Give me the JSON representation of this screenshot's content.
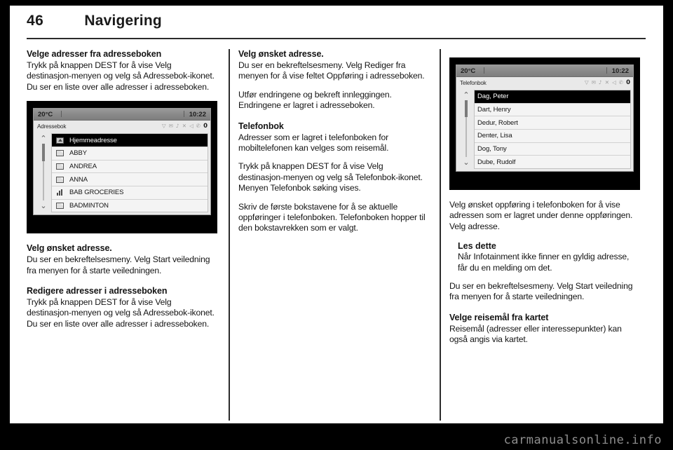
{
  "header": {
    "page_number": "46",
    "chapter": "Navigering"
  },
  "watermark": "carmanualsonline.info",
  "columns": {
    "col1": {
      "blocks": [
        {
          "kind": "heading",
          "text": "Velge adresser fra adresseboken"
        },
        {
          "kind": "body",
          "text": "Trykk på knappen DEST for å vise Velg destinasjon-menyen og velg så Adressebok-ikonet. Du ser en liste over alle adresser i adresseboken."
        },
        {
          "kind": "figure",
          "ref": "address_book_screen"
        },
        {
          "kind": "heading",
          "text": "Velg ønsket adresse."
        },
        {
          "kind": "body",
          "text": "Du ser en bekreftelsesmeny. Velg Start veiledning fra menyen for å starte veiledningen."
        },
        {
          "kind": "heading",
          "text": "Redigere adresser i adresseboken"
        },
        {
          "kind": "body",
          "text": "Trykk på knappen DEST for å vise Velg destinasjon-menyen og velg så Adressebok-ikonet. Du ser en liste over alle adresser i adresseboken."
        }
      ]
    },
    "col2": {
      "blocks": [
        {
          "kind": "heading",
          "text": "Velg ønsket adresse."
        },
        {
          "kind": "body",
          "text": "Du ser en bekreftelsesmeny. Velg Rediger fra menyen for å vise feltet Oppføring i adresseboken."
        },
        {
          "kind": "body",
          "text": "Utfør endringene og bekreft innleggingen. Endringene er lagret i adresseboken."
        },
        {
          "kind": "heading",
          "text": "Telefonbok"
        },
        {
          "kind": "body",
          "text": "Adresser som er lagret i telefonboken for mobiltelefonen kan velges som reisemål."
        },
        {
          "kind": "body",
          "text": "Trykk på knappen DEST for å vise Velg destinasjon-menyen og velg så Telefonbok-ikonet. Menyen Telefonbok søking vises."
        },
        {
          "kind": "body",
          "text": "Skriv de første bokstavene for å se aktuelle oppføringer i telefonboken. Telefonboken hopper til den bokstavrekken som er valgt."
        }
      ]
    },
    "col3": {
      "blocks": [
        {
          "kind": "figure",
          "ref": "phone_book_screen"
        },
        {
          "kind": "body",
          "text": "Velg ønsket oppføring i telefonboken for å vise adressen som er lagret under denne oppføringen. Velg adresse."
        },
        {
          "kind": "note",
          "title": "Les dette",
          "text": "Når Infotainment ikke finner en gyldig adresse, får du en melding om det."
        },
        {
          "kind": "body",
          "text": "Du ser en bekreftelsesmeny. Velg Start veiledning fra menyen for å starte veiledningen."
        },
        {
          "kind": "heading",
          "text": "Velge reisemål fra kartet"
        },
        {
          "kind": "body",
          "text": "Reisemål (adresser eller interessepunkter) kan også angis via kartet."
        }
      ]
    }
  },
  "figures": {
    "address_book_screen": {
      "status": {
        "temperature": "20°C",
        "clock": "10:22"
      },
      "title": "Adressebok",
      "status_icons": [
        "wifi-icon",
        "message-icon",
        "mute-icon",
        "shuffle-icon",
        "speaker-mute-icon",
        "phone-icon",
        "battery-icon"
      ],
      "battery_label": "0",
      "scroll_up": "⌃",
      "scroll_down": "⌄",
      "rows": [
        {
          "icon": "home-address-icon",
          "label": "Hjemmeadresse",
          "selected": true
        },
        {
          "icon": "contact-card-icon",
          "label": "ABBY",
          "selected": false
        },
        {
          "icon": "contact-card-icon",
          "label": "ANDREA",
          "selected": false
        },
        {
          "icon": "contact-card-icon",
          "label": "ANNA",
          "selected": false
        },
        {
          "icon": "business-icon",
          "label": "BAB GROCERIES",
          "selected": false
        },
        {
          "icon": "contact-card-icon",
          "label": "BADMINTON",
          "selected": false
        }
      ]
    },
    "phone_book_screen": {
      "status": {
        "temperature": "20°C",
        "clock": "10:22"
      },
      "title": "Telefonbok",
      "status_icons": [
        "wifi-icon",
        "message-icon",
        "mute-icon",
        "shuffle-icon",
        "speaker-mute-icon",
        "phone-icon",
        "battery-icon"
      ],
      "battery_label": "0",
      "scroll_up": "⌃",
      "scroll_down": "⌄",
      "rows": [
        {
          "icon": "none",
          "label": "Dag, Peter",
          "selected": true
        },
        {
          "icon": "none",
          "label": "Dart, Henry",
          "selected": false
        },
        {
          "icon": "none",
          "label": "Dedur, Robert",
          "selected": false
        },
        {
          "icon": "none",
          "label": "Denter, Lisa",
          "selected": false
        },
        {
          "icon": "none",
          "label": "Dog, Tony",
          "selected": false
        },
        {
          "icon": "none",
          "label": "Dube, Rudolf",
          "selected": false
        }
      ]
    }
  },
  "colors": {
    "text": "#141414",
    "rule": "#2b2b2b",
    "screen_bg": "#e9e9e9",
    "selection": "#000000",
    "watermark": "#8e8e8e"
  }
}
